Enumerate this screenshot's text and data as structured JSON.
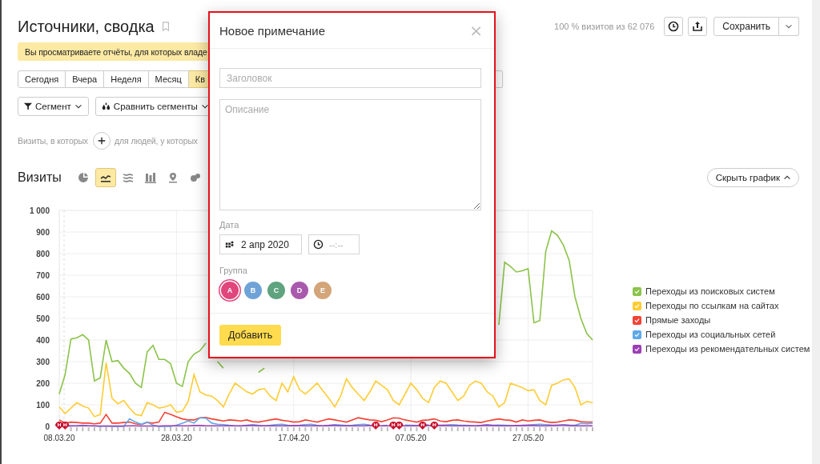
{
  "header": {
    "title": "Источники, сводка",
    "sample_info": "100 % визитов из 62 076",
    "save_button": "Сохранить"
  },
  "banner": {
    "text": "Вы просматриваете отчёты, для которых владе"
  },
  "periods": [
    {
      "label": "Сегодня",
      "selected": false
    },
    {
      "label": "Вчера",
      "selected": false
    },
    {
      "label": "Неделя",
      "selected": false
    },
    {
      "label": "Месяц",
      "selected": false
    },
    {
      "label": "Кв",
      "selected": true
    }
  ],
  "segment_buttons": [
    {
      "kind": "filter",
      "label": "Сегмент"
    },
    {
      "kind": "compare",
      "label": "Сравнить сегменты"
    }
  ],
  "filter_row": {
    "prefix": "Визиты, в которых",
    "suffix": "для людей, у которых"
  },
  "chart": {
    "title": "Визиты",
    "toggle_button": "Скрыть график",
    "day_has_note": [
      true,
      true,
      false,
      false,
      false,
      false,
      false,
      false,
      false,
      false,
      false,
      false,
      false,
      false,
      false,
      false,
      false,
      false,
      false,
      false,
      false,
      false,
      false,
      false,
      false,
      false,
      false,
      false,
      false,
      false,
      false,
      false,
      false,
      false,
      false,
      false,
      false,
      false,
      false,
      false,
      false,
      false,
      false,
      false,
      false,
      false,
      false,
      false,
      false,
      false,
      false,
      false,
      false,
      false,
      true,
      false,
      false,
      true,
      true,
      false,
      false,
      false,
      true,
      false,
      true,
      false,
      false,
      false,
      false,
      false,
      false,
      false,
      false,
      false,
      false,
      false,
      false,
      false,
      false,
      false,
      false,
      false,
      false,
      false,
      false,
      false,
      false,
      false,
      false,
      false,
      false,
      false
    ],
    "view_types": [
      {
        "kind": "pie",
        "selected": false
      },
      {
        "kind": "line",
        "selected": true
      },
      {
        "kind": "stacked",
        "selected": false
      },
      {
        "kind": "bars",
        "selected": false
      },
      {
        "kind": "map",
        "selected": false
      },
      {
        "kind": "bubble",
        "selected": false
      }
    ],
    "chart_data": {
      "type": "line",
      "grid": true,
      "ylim": [
        0,
        1000
      ],
      "categories": [
        "08.03.20",
        null,
        null,
        null,
        null,
        null,
        null,
        null,
        null,
        null,
        null,
        null,
        null,
        null,
        null,
        null,
        null,
        null,
        null,
        null,
        "28.03.20",
        null,
        null,
        null,
        null,
        null,
        null,
        null,
        null,
        null,
        null,
        null,
        null,
        null,
        null,
        null,
        null,
        null,
        null,
        null,
        "17.04.20",
        null,
        null,
        null,
        null,
        null,
        null,
        null,
        null,
        null,
        null,
        null,
        null,
        null,
        null,
        null,
        null,
        null,
        null,
        null,
        "07.05.20",
        null,
        null,
        null,
        null,
        null,
        null,
        null,
        null,
        null,
        null,
        null,
        null,
        null,
        null,
        null,
        null,
        null,
        null,
        null,
        "27.05.20",
        null,
        null,
        null,
        null,
        null,
        null,
        null,
        null,
        null,
        null,
        null
      ],
      "yticks": [
        0,
        100,
        200,
        300,
        400,
        500,
        600,
        700,
        800,
        900,
        {
          "value": 1000,
          "label": "1 000"
        }
      ],
      "series": [
        {
          "name": "Переходы из поисковых систем",
          "color": "#8bc34a",
          "values": [
            150,
            240,
            405,
            410,
            425,
            400,
            210,
            225,
            400,
            300,
            305,
            270,
            245,
            200,
            180,
            345,
            375,
            310,
            310,
            290,
            200,
            185,
            300,
            335,
            350,
            385,
            null,
            300,
            270,
            null,
            null,
            null,
            null,
            null,
            250,
            270,
            null,
            null,
            null,
            null,
            null,
            null,
            null,
            null,
            null,
            null,
            null,
            null,
            null,
            null,
            null,
            null,
            null,
            null,
            null,
            null,
            null,
            null,
            null,
            null,
            null,
            null,
            null,
            null,
            null,
            null,
            null,
            null,
            null,
            null,
            null,
            null,
            null,
            null,
            null,
            470,
            760,
            740,
            715,
            720,
            730,
            480,
            490,
            810,
            905,
            885,
            840,
            770,
            600,
            500,
            430,
            400
          ]
        },
        {
          "name": "Переходы по ссылкам на сайтах",
          "color": "#ffcc33",
          "values": [
            90,
            60,
            85,
            110,
            95,
            85,
            45,
            55,
            295,
            130,
            105,
            120,
            85,
            55,
            50,
            110,
            100,
            85,
            90,
            100,
            65,
            70,
            115,
            240,
            160,
            145,
            140,
            120,
            90,
            150,
            200,
            180,
            160,
            150,
            170,
            175,
            140,
            120,
            200,
            160,
            230,
            170,
            150,
            175,
            200,
            165,
            130,
            90,
            140,
            220,
            180,
            150,
            120,
            160,
            210,
            190,
            170,
            120,
            100,
            150,
            200,
            170,
            130,
            110,
            180,
            210,
            200,
            160,
            120,
            140,
            190,
            210,
            200,
            160,
            140,
            90,
            110,
            200,
            190,
            180,
            165,
            170,
            120,
            100,
            190,
            200,
            215,
            220,
            180,
            100,
            115,
            110
          ]
        },
        {
          "name": "Прямые заходы",
          "color": "#f44336",
          "values": [
            30,
            15,
            20,
            18,
            15,
            15,
            12,
            15,
            55,
            15,
            15,
            18,
            20,
            12,
            8,
            18,
            15,
            20,
            65,
            55,
            45,
            35,
            30,
            30,
            40,
            42,
            35,
            30,
            25,
            30,
            28,
            25,
            30,
            22,
            20,
            25,
            30,
            35,
            28,
            25,
            20,
            22,
            30,
            25,
            20,
            28,
            35,
            30,
            25,
            20,
            30,
            40,
            35,
            30,
            28,
            22,
            30,
            40,
            38,
            30,
            25,
            20,
            28,
            30,
            35,
            25,
            22,
            28,
            30,
            25,
            22,
            20,
            18,
            25,
            30,
            35,
            30,
            28,
            20,
            30,
            25,
            28,
            30,
            22,
            18,
            20,
            25,
            30,
            28,
            22,
            20,
            20
          ]
        },
        {
          "name": "Переходы из социальных сетей",
          "color": "#5ea9e8",
          "values": [
            0,
            0,
            2,
            3,
            5,
            3,
            2,
            0,
            2,
            0,
            0,
            0,
            35,
            20,
            10,
            20,
            5,
            0,
            0,
            0,
            5,
            15,
            25,
            15,
            40,
            38,
            15,
            10,
            8,
            5,
            3,
            2,
            5,
            8,
            5,
            3,
            5,
            8,
            10,
            5,
            3,
            5,
            8,
            10,
            5,
            3,
            5,
            8,
            6,
            4,
            5,
            8,
            10,
            6,
            null,
            3,
            5,
            null,
            null,
            6,
            5,
            4,
            6,
            8,
            null,
            4,
            6,
            8,
            6,
            5,
            4,
            3,
            5,
            8,
            5,
            6,
            5,
            4,
            3,
            5,
            6,
            8,
            10,
            8,
            6,
            5,
            8,
            6,
            5,
            14,
            12,
            14
          ]
        },
        {
          "name": "Переходы из рекомендательных систем",
          "color": "#9c3fb5",
          "values": [
            3,
            3,
            3,
            3,
            3,
            3,
            3,
            2,
            2,
            2,
            2,
            2,
            3,
            3,
            2,
            2,
            2,
            2,
            3,
            3,
            3,
            3,
            3,
            4,
            4,
            3,
            3,
            3,
            3,
            3,
            3,
            3,
            4,
            4,
            3,
            3,
            3,
            3,
            3,
            3,
            4,
            4,
            3,
            3,
            3,
            3,
            4,
            4,
            3,
            3,
            3,
            3,
            3,
            4,
            4,
            3,
            3,
            3,
            3,
            3,
            3,
            3,
            3,
            4,
            4,
            5,
            4,
            3,
            3,
            3,
            3,
            3,
            4,
            5,
            4,
            3,
            3,
            3,
            4,
            4,
            5,
            4,
            3,
            3,
            4,
            5,
            5,
            4,
            3,
            3,
            3,
            3
          ]
        }
      ]
    }
  },
  "legend": [
    {
      "checked": true
    },
    {
      "checked": true
    },
    {
      "checked": true
    },
    {
      "checked": true
    },
    {
      "checked": true
    }
  ],
  "note_dialog": {
    "title": "Новое примечание",
    "close": "×",
    "title_field": {
      "placeholder": "Заголовок"
    },
    "description_field": {
      "placeholder": "Описание"
    },
    "date_label": "Дата",
    "date": "2 апр 2020",
    "time_field": {
      "placeholder": "--:--"
    },
    "group_label": "Группа",
    "groups": [
      {
        "label": "A",
        "color": "#e0457b",
        "selected": true
      },
      {
        "label": "B",
        "color": "#6fa3d8",
        "selected": false
      },
      {
        "label": "C",
        "color": "#5fa37f",
        "selected": false
      },
      {
        "label": "D",
        "color": "#a95aad",
        "selected": false
      },
      {
        "label": "E",
        "color": "#d3a579",
        "selected": false
      }
    ],
    "submit": "Добавить"
  }
}
